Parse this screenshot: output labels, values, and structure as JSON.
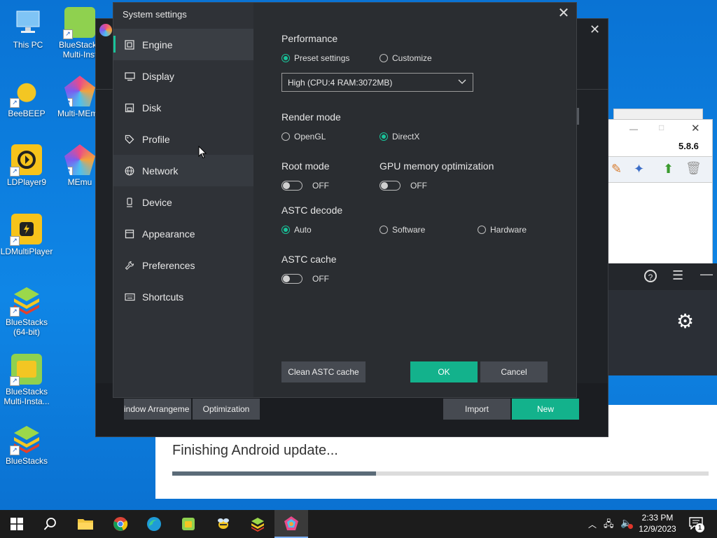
{
  "desktop": {
    "icons": [
      {
        "label": "This PC",
        "icon": "this-pc-icon"
      },
      {
        "label": "BlueStacks Multi-Inst",
        "icon": "bluestacks-multi-instance-icon"
      },
      {
        "label": "BeeBEEP",
        "icon": "beebeep-icon"
      },
      {
        "label": "Multi-MEmu",
        "icon": "multi-memu-icon"
      },
      {
        "label": "LDPlayer9",
        "icon": "ldplayer9-icon"
      },
      {
        "label": "MEmu",
        "icon": "memu-icon"
      },
      {
        "label": "LDMultiPlayer",
        "icon": "ldmultiplayer-icon"
      },
      {
        "label": "BlueStacks (64-bit)",
        "icon": "bluestacks-64bit-icon"
      },
      {
        "label": "BlueStacks Multi-Insta...",
        "icon": "bluestacks-multi-instance-2-icon"
      },
      {
        "label": "BlueStacks",
        "icon": "bluestacks-icon"
      }
    ]
  },
  "background": {
    "right_version": "5.8.6",
    "update_text": "Finishing Android update...",
    "update_progress": 0.38
  },
  "settings": {
    "title": "System settings",
    "nav": [
      {
        "label": "Engine",
        "icon": "engine-chip-icon",
        "active": true
      },
      {
        "label": "Display",
        "icon": "display-monitor-icon"
      },
      {
        "label": "Disk",
        "icon": "disk-icon"
      },
      {
        "label": "Profile",
        "icon": "profile-tag-icon"
      },
      {
        "label": "Network",
        "icon": "network-globe-icon"
      },
      {
        "label": "Device",
        "icon": "device-phone-icon"
      },
      {
        "label": "Appearance",
        "icon": "appearance-window-icon"
      },
      {
        "label": "Preferences",
        "icon": "preferences-wrench-icon"
      },
      {
        "label": "Shortcuts",
        "icon": "shortcuts-keyboard-icon"
      }
    ],
    "performance": {
      "label": "Performance",
      "options": [
        "Preset settings",
        "Customize"
      ],
      "selected": "Preset settings",
      "preset_value": "High (CPU:4 RAM:3072MB)"
    },
    "render_mode": {
      "label": "Render mode",
      "options": [
        "OpenGL",
        "DirectX"
      ],
      "selected": "DirectX"
    },
    "root_mode": {
      "label": "Root mode",
      "state": "OFF"
    },
    "gpu_memory": {
      "label": "GPU memory optimization",
      "state": "OFF"
    },
    "astc_decode": {
      "label": "ASTC decode",
      "options": [
        "Auto",
        "Software",
        "Hardware"
      ],
      "selected": "Auto"
    },
    "astc_cache": {
      "label": "ASTC cache",
      "state": "OFF"
    },
    "buttons": {
      "clean_cache": "Clean ASTC cache",
      "ok": "OK",
      "cancel": "Cancel"
    }
  },
  "emulator_bar": {
    "window_arrangement": "indow Arrangeme",
    "optimization": "Optimization",
    "import": "Import",
    "new": "New"
  },
  "taskbar": {
    "time": "2:33 PM",
    "date": "12/9/2023",
    "notification_count": "1"
  },
  "colors": {
    "accent": "#13b28c",
    "desktop": "#0d7ad6",
    "dialog_bg": "#2a2d31"
  }
}
